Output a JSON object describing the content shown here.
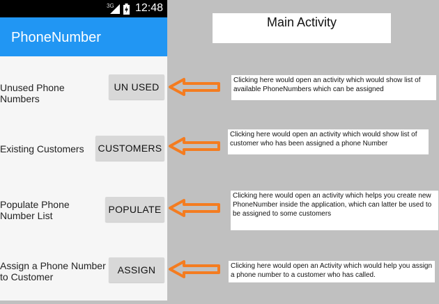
{
  "status_bar": {
    "network": "3G",
    "time": "12:48",
    "icons": [
      "signal-icon",
      "battery-icon"
    ]
  },
  "app_bar": {
    "title": "PhoneNumber"
  },
  "header_box": {
    "title": "Main Activity"
  },
  "rows": [
    {
      "label": "Unused Phone Numbers",
      "button": "UN USED",
      "note": "Clicking here would open an activity which would show list of available PhoneNumbers which can be assigned"
    },
    {
      "label": "Existing Customers",
      "button": "CUSTOMERS",
      "note": "Clicking here would open an activity which would show list of customer who has been assigned a phone Number"
    },
    {
      "label": "Populate Phone Number List",
      "button": "POPULATE",
      "note": "Clicking here would open an activity which helps you create new PhoneNumber inside the application, which can latter be used to be assigned to some customers"
    },
    {
      "label": "Assign a Phone Number to Customer",
      "button": "ASSIGN",
      "note": "Clicking here would open an Activity which would help you assign a phone number to a customer who has called."
    }
  ],
  "colors": {
    "app_bar": "#2196f3",
    "arrow": "#f47c20",
    "canvas": "#c0c0c0"
  }
}
